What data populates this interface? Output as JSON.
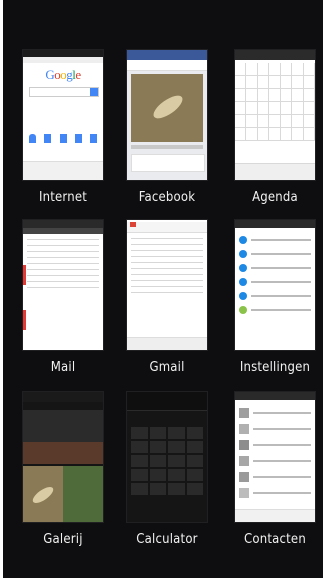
{
  "apps": [
    {
      "key": "internet",
      "label": "Internet",
      "content": {
        "logo": "Google"
      }
    },
    {
      "key": "facebook",
      "label": "Facebook"
    },
    {
      "key": "agenda",
      "label": "Agenda"
    },
    {
      "key": "mail",
      "label": "Mail"
    },
    {
      "key": "gmail",
      "label": "Gmail"
    },
    {
      "key": "instellingen",
      "label": "Instellingen"
    },
    {
      "key": "galerij",
      "label": "Galerij"
    },
    {
      "key": "calculator",
      "label": "Calculator"
    },
    {
      "key": "contacten",
      "label": "Contacten"
    }
  ],
  "colors": {
    "background": "#0e0e10",
    "facebook_blue": "#3b5998",
    "google_blue": "#4285f4",
    "google_red": "#db4437",
    "google_yellow": "#f4b400",
    "google_green": "#0f9d58"
  }
}
